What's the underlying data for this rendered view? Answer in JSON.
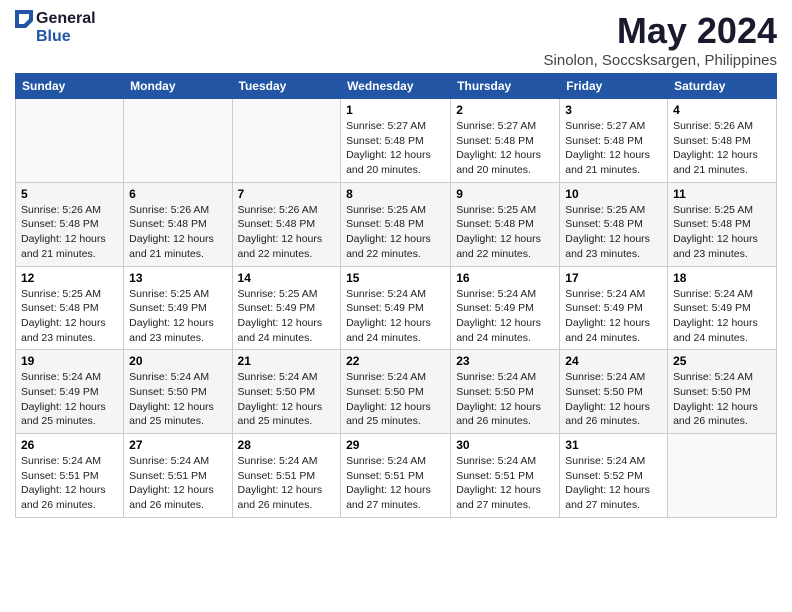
{
  "logo": {
    "general": "General",
    "blue": "Blue"
  },
  "title": {
    "month_year": "May 2024",
    "location": "Sinolon, Soccsksargen, Philippines"
  },
  "weekdays": [
    "Sunday",
    "Monday",
    "Tuesday",
    "Wednesday",
    "Thursday",
    "Friday",
    "Saturday"
  ],
  "weeks": [
    [
      {
        "day": "",
        "sunrise": "",
        "sunset": "",
        "daylight": ""
      },
      {
        "day": "",
        "sunrise": "",
        "sunset": "",
        "daylight": ""
      },
      {
        "day": "",
        "sunrise": "",
        "sunset": "",
        "daylight": ""
      },
      {
        "day": "1",
        "sunrise": "Sunrise: 5:27 AM",
        "sunset": "Sunset: 5:48 PM",
        "daylight": "Daylight: 12 hours and 20 minutes."
      },
      {
        "day": "2",
        "sunrise": "Sunrise: 5:27 AM",
        "sunset": "Sunset: 5:48 PM",
        "daylight": "Daylight: 12 hours and 20 minutes."
      },
      {
        "day": "3",
        "sunrise": "Sunrise: 5:27 AM",
        "sunset": "Sunset: 5:48 PM",
        "daylight": "Daylight: 12 hours and 21 minutes."
      },
      {
        "day": "4",
        "sunrise": "Sunrise: 5:26 AM",
        "sunset": "Sunset: 5:48 PM",
        "daylight": "Daylight: 12 hours and 21 minutes."
      }
    ],
    [
      {
        "day": "5",
        "sunrise": "Sunrise: 5:26 AM",
        "sunset": "Sunset: 5:48 PM",
        "daylight": "Daylight: 12 hours and 21 minutes."
      },
      {
        "day": "6",
        "sunrise": "Sunrise: 5:26 AM",
        "sunset": "Sunset: 5:48 PM",
        "daylight": "Daylight: 12 hours and 21 minutes."
      },
      {
        "day": "7",
        "sunrise": "Sunrise: 5:26 AM",
        "sunset": "Sunset: 5:48 PM",
        "daylight": "Daylight: 12 hours and 22 minutes."
      },
      {
        "day": "8",
        "sunrise": "Sunrise: 5:25 AM",
        "sunset": "Sunset: 5:48 PM",
        "daylight": "Daylight: 12 hours and 22 minutes."
      },
      {
        "day": "9",
        "sunrise": "Sunrise: 5:25 AM",
        "sunset": "Sunset: 5:48 PM",
        "daylight": "Daylight: 12 hours and 22 minutes."
      },
      {
        "day": "10",
        "sunrise": "Sunrise: 5:25 AM",
        "sunset": "Sunset: 5:48 PM",
        "daylight": "Daylight: 12 hours and 23 minutes."
      },
      {
        "day": "11",
        "sunrise": "Sunrise: 5:25 AM",
        "sunset": "Sunset: 5:48 PM",
        "daylight": "Daylight: 12 hours and 23 minutes."
      }
    ],
    [
      {
        "day": "12",
        "sunrise": "Sunrise: 5:25 AM",
        "sunset": "Sunset: 5:48 PM",
        "daylight": "Daylight: 12 hours and 23 minutes."
      },
      {
        "day": "13",
        "sunrise": "Sunrise: 5:25 AM",
        "sunset": "Sunset: 5:49 PM",
        "daylight": "Daylight: 12 hours and 23 minutes."
      },
      {
        "day": "14",
        "sunrise": "Sunrise: 5:25 AM",
        "sunset": "Sunset: 5:49 PM",
        "daylight": "Daylight: 12 hours and 24 minutes."
      },
      {
        "day": "15",
        "sunrise": "Sunrise: 5:24 AM",
        "sunset": "Sunset: 5:49 PM",
        "daylight": "Daylight: 12 hours and 24 minutes."
      },
      {
        "day": "16",
        "sunrise": "Sunrise: 5:24 AM",
        "sunset": "Sunset: 5:49 PM",
        "daylight": "Daylight: 12 hours and 24 minutes."
      },
      {
        "day": "17",
        "sunrise": "Sunrise: 5:24 AM",
        "sunset": "Sunset: 5:49 PM",
        "daylight": "Daylight: 12 hours and 24 minutes."
      },
      {
        "day": "18",
        "sunrise": "Sunrise: 5:24 AM",
        "sunset": "Sunset: 5:49 PM",
        "daylight": "Daylight: 12 hours and 24 minutes."
      }
    ],
    [
      {
        "day": "19",
        "sunrise": "Sunrise: 5:24 AM",
        "sunset": "Sunset: 5:49 PM",
        "daylight": "Daylight: 12 hours and 25 minutes."
      },
      {
        "day": "20",
        "sunrise": "Sunrise: 5:24 AM",
        "sunset": "Sunset: 5:50 PM",
        "daylight": "Daylight: 12 hours and 25 minutes."
      },
      {
        "day": "21",
        "sunrise": "Sunrise: 5:24 AM",
        "sunset": "Sunset: 5:50 PM",
        "daylight": "Daylight: 12 hours and 25 minutes."
      },
      {
        "day": "22",
        "sunrise": "Sunrise: 5:24 AM",
        "sunset": "Sunset: 5:50 PM",
        "daylight": "Daylight: 12 hours and 25 minutes."
      },
      {
        "day": "23",
        "sunrise": "Sunrise: 5:24 AM",
        "sunset": "Sunset: 5:50 PM",
        "daylight": "Daylight: 12 hours and 26 minutes."
      },
      {
        "day": "24",
        "sunrise": "Sunrise: 5:24 AM",
        "sunset": "Sunset: 5:50 PM",
        "daylight": "Daylight: 12 hours and 26 minutes."
      },
      {
        "day": "25",
        "sunrise": "Sunrise: 5:24 AM",
        "sunset": "Sunset: 5:50 PM",
        "daylight": "Daylight: 12 hours and 26 minutes."
      }
    ],
    [
      {
        "day": "26",
        "sunrise": "Sunrise: 5:24 AM",
        "sunset": "Sunset: 5:51 PM",
        "daylight": "Daylight: 12 hours and 26 minutes."
      },
      {
        "day": "27",
        "sunrise": "Sunrise: 5:24 AM",
        "sunset": "Sunset: 5:51 PM",
        "daylight": "Daylight: 12 hours and 26 minutes."
      },
      {
        "day": "28",
        "sunrise": "Sunrise: 5:24 AM",
        "sunset": "Sunset: 5:51 PM",
        "daylight": "Daylight: 12 hours and 26 minutes."
      },
      {
        "day": "29",
        "sunrise": "Sunrise: 5:24 AM",
        "sunset": "Sunset: 5:51 PM",
        "daylight": "Daylight: 12 hours and 27 minutes."
      },
      {
        "day": "30",
        "sunrise": "Sunrise: 5:24 AM",
        "sunset": "Sunset: 5:51 PM",
        "daylight": "Daylight: 12 hours and 27 minutes."
      },
      {
        "day": "31",
        "sunrise": "Sunrise: 5:24 AM",
        "sunset": "Sunset: 5:52 PM",
        "daylight": "Daylight: 12 hours and 27 minutes."
      },
      {
        "day": "",
        "sunrise": "",
        "sunset": "",
        "daylight": ""
      }
    ]
  ]
}
